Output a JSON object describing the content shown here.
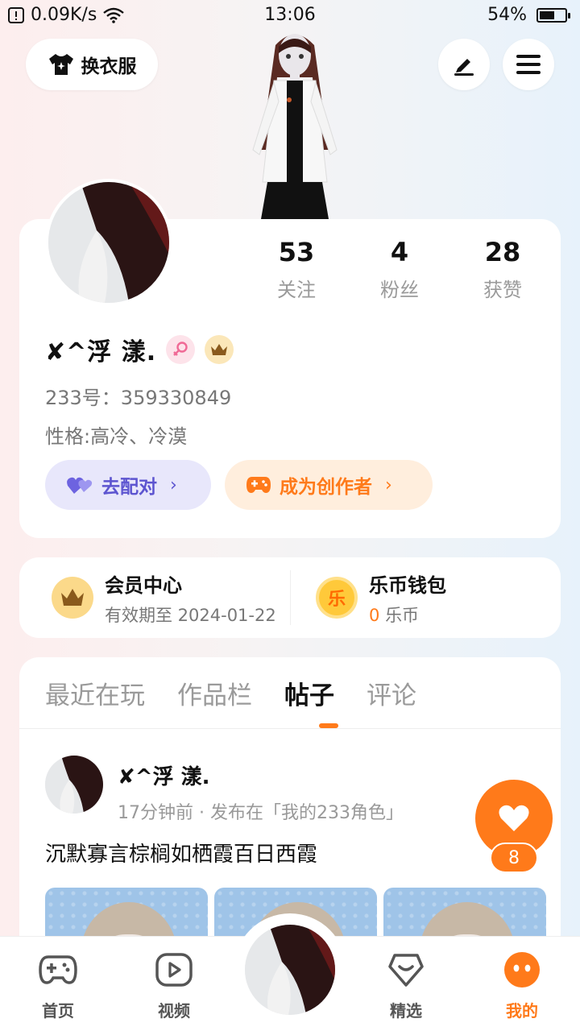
{
  "status_bar": {
    "network_speed": "0.09K/s",
    "time": "13:06",
    "battery_text": "54%",
    "battery_level": 54
  },
  "header": {
    "dress_label": "换衣服",
    "edit_icon": "pencil-icon",
    "menu_icon": "menu-icon"
  },
  "profile": {
    "stats": [
      {
        "value": "53",
        "label": "关注"
      },
      {
        "value": "4",
        "label": "粉丝"
      },
      {
        "value": "28",
        "label": "获赞"
      }
    ],
    "username": "✘^浮  漾.",
    "id_line": "233号：359330849",
    "bio": "性格:高冷、冷漠",
    "match_label": "去配对",
    "creator_label": "成为创作者"
  },
  "wallet": {
    "member": {
      "title": "会员中心",
      "sub": "有效期至 2024-01-22"
    },
    "coins": {
      "title": "乐币钱包",
      "amount": "0",
      "unit": "乐币",
      "icon_char": "乐"
    }
  },
  "tabs": [
    "最近在玩",
    "作品栏",
    "帖子",
    "评论"
  ],
  "active_tab": "帖子",
  "post": {
    "author": "✘^浮  漾.",
    "meta": "17分钟前 · 发布在「我的233角色」",
    "text": "沉默寡言棕榈如栖霞百日西霞",
    "like_count": "8"
  },
  "nav": [
    {
      "label": "首页",
      "icon": "gamepad-icon"
    },
    {
      "label": "视频",
      "icon": "play-icon"
    },
    {
      "label": "",
      "icon": "avatar-center"
    },
    {
      "label": "精选",
      "icon": "heart-box-icon"
    },
    {
      "label": "我的",
      "icon": "face-icon"
    }
  ],
  "colors": {
    "accent": "#ff7a1a",
    "match": "#5d55d0",
    "match_bg": "#e8e7fb",
    "creator_bg": "#ffeedd"
  }
}
